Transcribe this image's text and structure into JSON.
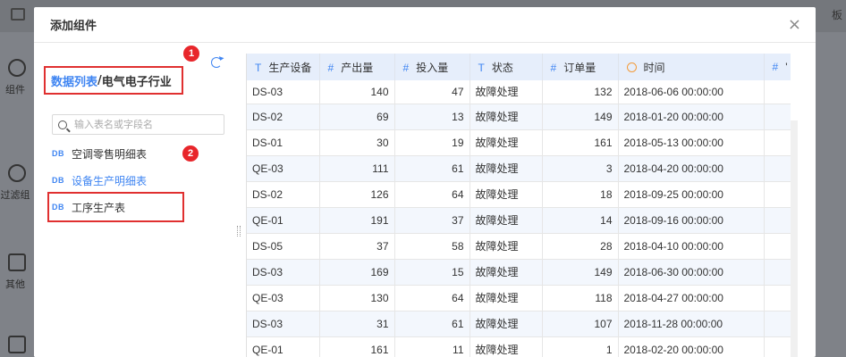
{
  "background": {
    "top_right_label": "板",
    "sidebar": [
      {
        "label": "组件"
      },
      {
        "label": "过滤组"
      },
      {
        "label": "其他"
      }
    ]
  },
  "modal": {
    "title": "添加组件",
    "close_icon": "×"
  },
  "left_panel": {
    "breadcrumb": {
      "link": "数据列表",
      "separator": "/",
      "current": "电气电子行业"
    },
    "search_placeholder": "输入表名或字段名",
    "tables": [
      {
        "icon": "DB",
        "label": "空调零售明细表"
      },
      {
        "icon": "DB",
        "label": "设备生产明细表"
      },
      {
        "icon": "DB",
        "label": "工序生产表"
      }
    ],
    "badges": [
      "1",
      "2"
    ]
  },
  "grid": {
    "columns": [
      {
        "type": "T",
        "label": "生产设备"
      },
      {
        "type": "#",
        "label": "产出量"
      },
      {
        "type": "#",
        "label": "投入量"
      },
      {
        "type": "T",
        "label": "状态"
      },
      {
        "type": "#",
        "label": "订单量"
      },
      {
        "type": "clock",
        "label": "时间"
      },
      {
        "type": "#",
        "label": "'"
      }
    ],
    "rows": [
      [
        "DS-03",
        "140",
        "47",
        "故障处理",
        "132",
        "2018-06-06 00:00:00",
        ""
      ],
      [
        "DS-02",
        "69",
        "13",
        "故障处理",
        "149",
        "2018-01-20 00:00:00",
        ""
      ],
      [
        "DS-01",
        "30",
        "19",
        "故障处理",
        "161",
        "2018-05-13 00:00:00",
        ""
      ],
      [
        "QE-03",
        "111",
        "61",
        "故障处理",
        "3",
        "2018-04-20 00:00:00",
        ""
      ],
      [
        "DS-02",
        "126",
        "64",
        "故障处理",
        "18",
        "2018-09-25 00:00:00",
        ""
      ],
      [
        "QE-01",
        "191",
        "37",
        "故障处理",
        "14",
        "2018-09-16 00:00:00",
        ""
      ],
      [
        "DS-05",
        "37",
        "58",
        "故障处理",
        "28",
        "2018-04-10 00:00:00",
        ""
      ],
      [
        "DS-03",
        "169",
        "15",
        "故障处理",
        "149",
        "2018-06-30 00:00:00",
        ""
      ],
      [
        "QE-03",
        "130",
        "64",
        "故障处理",
        "118",
        "2018-04-27 00:00:00",
        ""
      ],
      [
        "DS-03",
        "31",
        "61",
        "故障处理",
        "107",
        "2018-11-28 00:00:00",
        ""
      ],
      [
        "QE-01",
        "161",
        "11",
        "故障处理",
        "1",
        "2018-02-20 00:00:00",
        ""
      ]
    ]
  }
}
